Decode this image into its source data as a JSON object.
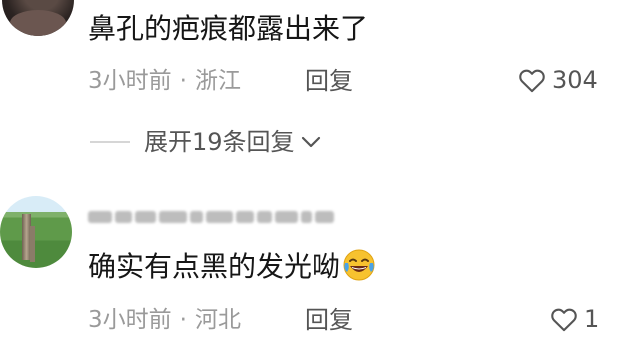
{
  "comments": [
    {
      "text": "鼻孔的疤痕都露出来了",
      "time": "3小时前",
      "separator": "·",
      "location": "浙江",
      "reply_label": "回复",
      "likes": "304"
    },
    {
      "text": "确实有点黑的发光呦",
      "emoji": "face-with-tears-of-joy",
      "time": "3小时前",
      "separator": "·",
      "location": "河北",
      "reply_label": "回复",
      "likes": "1"
    }
  ],
  "expand_replies": {
    "label": "展开19条回复"
  },
  "icons": {
    "like": "heart-outline-icon",
    "expand": "chevron-down-icon"
  },
  "colors": {
    "text": "#161616",
    "meta": "#9a9a9a",
    "action": "#555555",
    "emoji_yellow": "#f7c22f"
  }
}
